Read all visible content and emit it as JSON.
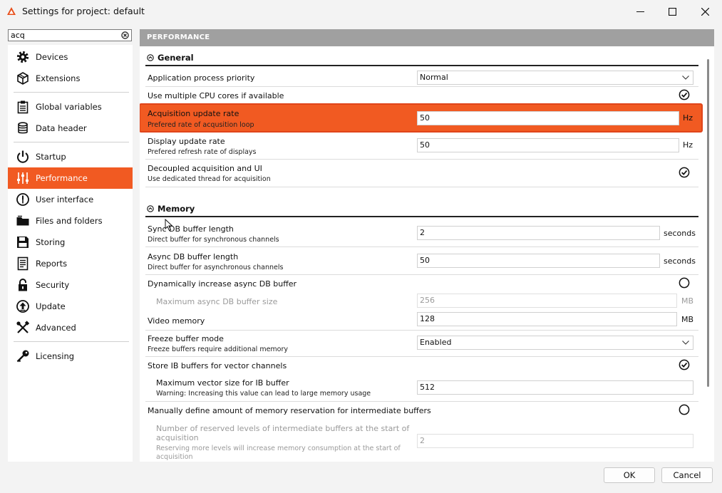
{
  "window": {
    "title": "Settings for project: default",
    "minimize_icon": "minimize-icon",
    "maximize_icon": "maximize-icon",
    "close_icon": "close-icon",
    "accent": "#f15a22"
  },
  "search": {
    "value": "acq",
    "clear_icon": "clear-search-icon"
  },
  "sidebar": {
    "items": [
      {
        "label": "Devices",
        "icon": "gear-icon"
      },
      {
        "label": "Extensions",
        "icon": "cube-icon"
      },
      {
        "label": "Global variables",
        "icon": "clipboard-icon"
      },
      {
        "label": "Data header",
        "icon": "database-icon"
      },
      {
        "label": "Startup",
        "icon": "power-icon"
      },
      {
        "label": "Performance",
        "icon": "sliders-icon",
        "active": true
      },
      {
        "label": "User interface",
        "icon": "gauge-icon"
      },
      {
        "label": "Files and folders",
        "icon": "folder-icon"
      },
      {
        "label": "Storing",
        "icon": "disk-icon"
      },
      {
        "label": "Reports",
        "icon": "report-icon"
      },
      {
        "label": "Security",
        "icon": "lock-icon"
      },
      {
        "label": "Update",
        "icon": "update-icon"
      },
      {
        "label": "Advanced",
        "icon": "tools-icon"
      },
      {
        "label": "Licensing",
        "icon": "key-icon"
      }
    ]
  },
  "content": {
    "header": "PERFORMANCE",
    "general": {
      "title": "General",
      "priority_label": "Application process priority",
      "priority_value": "Normal",
      "cpu_label": "Use multiple CPU cores if available",
      "cpu_checked": true,
      "acq_label": "Acquisition update rate",
      "acq_desc": "Prefered rate of acqusition loop",
      "acq_value": "50",
      "acq_unit": "Hz",
      "disp_label": "Display update rate",
      "disp_desc": "Prefered refresh rate of displays",
      "disp_value": "50",
      "disp_unit": "Hz",
      "decoupled_label": "Decoupled acquisition and UI",
      "decoupled_desc": "Use dedicated thread for acquisition",
      "decoupled_checked": true
    },
    "memory": {
      "title": "Memory",
      "sync_label": "Sync DB buffer length",
      "sync_desc": "Direct buffer for synchronous channels",
      "sync_value": "2",
      "sync_unit": "seconds",
      "async_label": "Async DB buffer length",
      "async_desc": "Direct buffer for asynchronous channels",
      "async_value": "50",
      "async_unit": "seconds",
      "dyn_label": "Dynamically increase async DB buffer",
      "dyn_checked": false,
      "max_async_label": "Maximum async DB buffer size",
      "max_async_value": "256",
      "max_async_unit": "MB",
      "video_label": "Video memory",
      "video_value": "128",
      "video_unit": "MB",
      "freeze_label": "Freeze buffer mode",
      "freeze_desc": "Freeze buffers require additional memory",
      "freeze_value": "Enabled",
      "ib_label": "Store IB buffers for vector channels",
      "ib_checked": true,
      "maxvec_label": "Maximum vector size for IB buffer",
      "maxvec_desc": "Warning: Increasing this value can lead to large memory usage",
      "maxvec_value": "512",
      "manual_label": "Manually define amount of memory reservation for intermediate buffers",
      "manual_checked": false,
      "levels_label_1": "Number of reserved levels of intermediate buffers at the start of",
      "levels_label_2": "acquisition",
      "levels_desc_1": "Reserving more levels will increase memory consumption at the start of",
      "levels_desc_2": "acquisition",
      "levels_value": "2"
    }
  },
  "footer": {
    "ok": "OK",
    "cancel": "Cancel"
  }
}
